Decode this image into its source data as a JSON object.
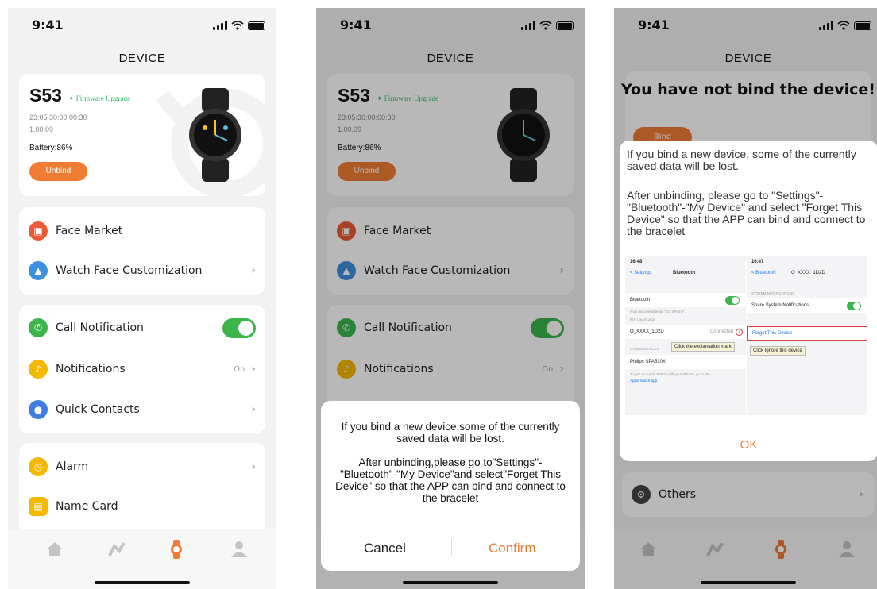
{
  "status": {
    "time": "9:41"
  },
  "nav": {
    "title": "DEVICE"
  },
  "device": {
    "model": "S53",
    "firmware_label": "Firmware Upgrade",
    "mac": "23:05:30:00:00:30",
    "version": "1.00.09",
    "battery": "Battery:86%",
    "unbind_label": "Unbind"
  },
  "menu": {
    "face_market": "Face Market",
    "watch_face_custom": "Watch Face Customization",
    "call_notification": "Call Notification",
    "notifications": "Notifications",
    "notifications_state": "On",
    "quick_contacts": "Quick Contacts",
    "alarm": "Alarm",
    "name_card": "Name Card",
    "others": "Others"
  },
  "confirm_dialog": {
    "line1": "If you bind a new device,some of the currently saved data will be lost.",
    "line2": "After unbinding,please go to\"Settings\"-\"Bluetooth\"-\"My Device\"and select\"Forget This Device\" so that the APP can bind and connect to the bracelet",
    "cancel": "Cancel",
    "confirm": "Confirm"
  },
  "bind_screen": {
    "title": "You have not bind the device!",
    "bind_label": "Bind",
    "p1": "If you bind a new device, some of the currently saved data will be lost.",
    "p2": "After unbinding, please go to \"Settings\"-\"Bluetooth\"-\"My Device\" and select \"Forget This Device\" so that the APP can bind and connect to the bracelet",
    "ok": "OK",
    "shot_left": {
      "time": "16:48",
      "back": "< Settings",
      "title": "Bluetooth",
      "bt_row": "Bluetooth",
      "discover": "Now discoverable as \"xx's iPhone\".",
      "my_devices": "MY DEVICES",
      "device": "O_XXXX_1D2D",
      "connected": "Connected",
      "tip": "Click the exclamation mark",
      "other_devices": "OTHER DEVICES",
      "philips": "Philips SPA510X",
      "pair_note": "To pair an Apple Watch with your iPhone, go to the",
      "watch_app": "Apple Watch app."
    },
    "shot_right": {
      "time": "16:47",
      "back": "< Bluetooth",
      "title": "O_XXXX_1D2D",
      "sys_notif": "SYSTEM NOTIFICATIONS",
      "share": "Share System Notifications",
      "forget": "Forget This Device",
      "tip": "Click Ignore this device"
    }
  },
  "colors": {
    "accent": "#f07c34",
    "green": "#3bb54a",
    "background": "#f2f2f2"
  }
}
